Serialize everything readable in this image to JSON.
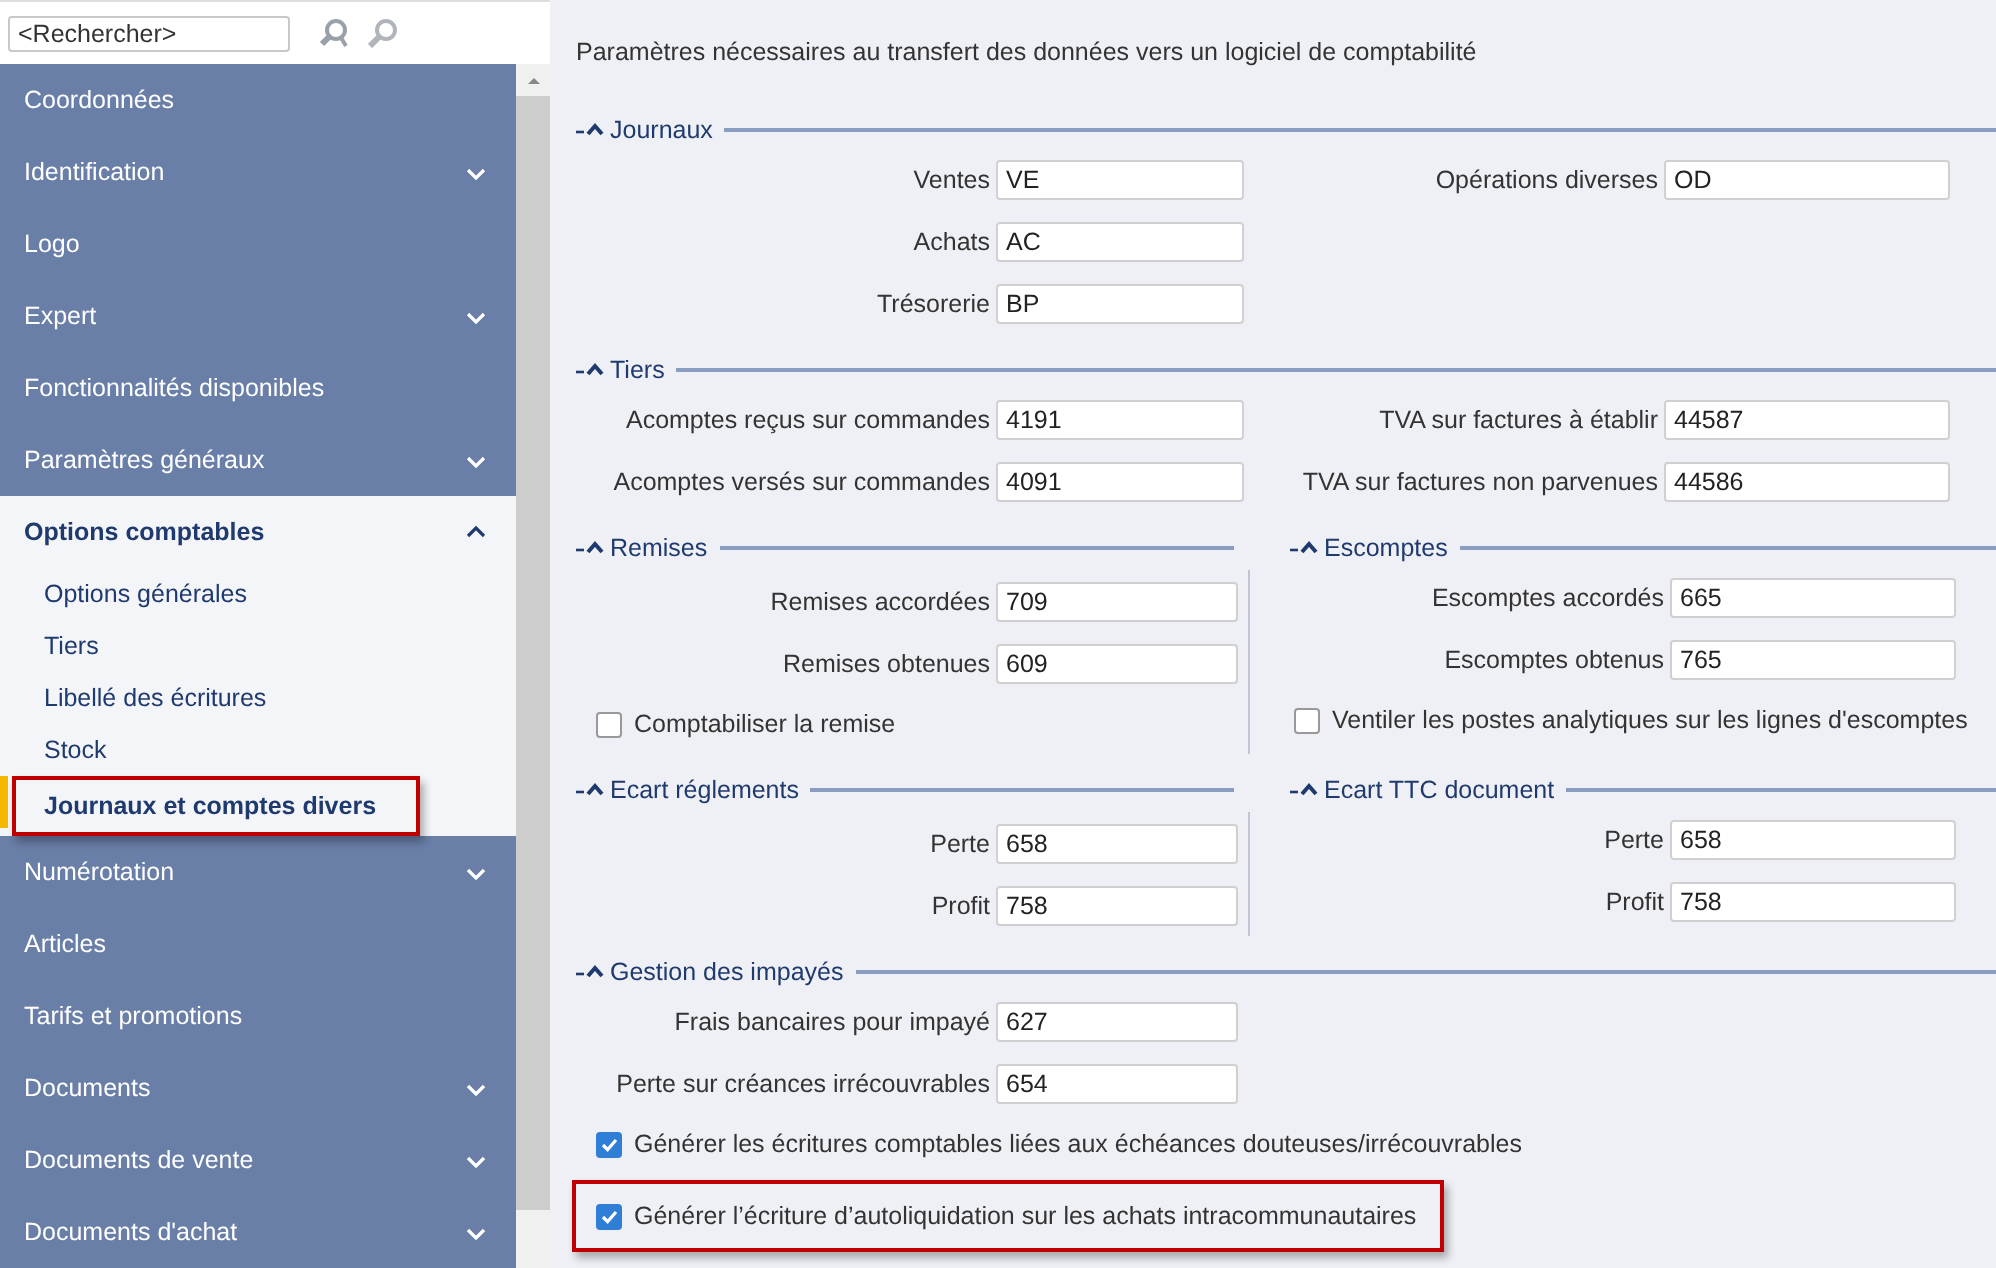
{
  "search": {
    "placeholder": "<Rechercher>"
  },
  "sidebar": {
    "items": [
      {
        "label": "Coordonnées",
        "kind": "link"
      },
      {
        "label": "Identification",
        "kind": "group",
        "expanded": false
      },
      {
        "label": "Logo",
        "kind": "link"
      },
      {
        "label": "Expert",
        "kind": "group",
        "expanded": false
      },
      {
        "label": "Fonctionnalités disponibles",
        "kind": "link"
      },
      {
        "label": "Paramètres généraux",
        "kind": "group",
        "expanded": false
      },
      {
        "label": "Options comptables",
        "kind": "group",
        "expanded": true,
        "children": [
          {
            "label": "Options générales",
            "selected": false,
            "highlighted": false
          },
          {
            "label": "Tiers",
            "selected": false,
            "highlighted": false
          },
          {
            "label": "Libellé des écritures",
            "selected": false,
            "highlighted": false
          },
          {
            "label": "Stock",
            "selected": false,
            "highlighted": false
          },
          {
            "label": "Journaux et comptes divers",
            "selected": true,
            "highlighted": true
          }
        ]
      },
      {
        "label": "Numérotation",
        "kind": "group",
        "expanded": false
      },
      {
        "label": "Articles",
        "kind": "link"
      },
      {
        "label": "Tarifs et promotions",
        "kind": "link"
      },
      {
        "label": "Documents",
        "kind": "group",
        "expanded": false
      },
      {
        "label": "Documents de vente",
        "kind": "group",
        "expanded": false
      },
      {
        "label": "Documents d'achat",
        "kind": "group",
        "expanded": false
      }
    ]
  },
  "panel": {
    "description": "Paramètres nécessaires au transfert des données vers un logiciel de comptabilité",
    "sections": [
      {
        "kind": "group",
        "title": "Journaux",
        "expanded": true,
        "columns": [
          [
            {
              "label": "Ventes",
              "value": "VE"
            },
            {
              "label": "Achats",
              "value": "AC"
            },
            {
              "label": "Trésorerie",
              "value": "BP"
            }
          ],
          [
            {
              "label": "Opérations diverses",
              "value": "OD"
            }
          ]
        ]
      },
      {
        "kind": "group",
        "title": "Tiers",
        "expanded": true,
        "columns": [
          [
            {
              "label": "Acomptes reçus sur commandes",
              "value": "4191"
            },
            {
              "label": "Acomptes versés sur commandes",
              "value": "4091"
            }
          ],
          [
            {
              "label": "TVA sur factures à établir",
              "value": "44587"
            },
            {
              "label": "TVA sur factures non parvenues",
              "value": "44586"
            }
          ]
        ]
      },
      {
        "kind": "split",
        "groups": [
          {
            "title": "Remises",
            "expanded": true,
            "columns": [
              [
                {
                  "label": "Remises accordées",
                  "value": "709"
                },
                {
                  "label": "Remises obtenues",
                  "value": "609"
                }
              ]
            ],
            "checkboxes": [
              {
                "label": "Comptabiliser la remise",
                "checked": false,
                "highlighted": false
              }
            ]
          },
          {
            "title": "Escomptes",
            "expanded": true,
            "columns": [
              [
                {
                  "label": "Escomptes accordés",
                  "value": "665"
                },
                {
                  "label": "Escomptes obtenus",
                  "value": "765"
                }
              ]
            ],
            "checkboxes": [
              {
                "label": "Ventiler les postes analytiques sur les lignes d'escomptes",
                "checked": false,
                "highlighted": false
              }
            ]
          }
        ]
      },
      {
        "kind": "split",
        "groups": [
          {
            "title": "Ecart réglements",
            "expanded": true,
            "columns": [
              [
                {
                  "label": "Perte",
                  "value": "658"
                },
                {
                  "label": "Profit",
                  "value": "758"
                }
              ]
            ]
          },
          {
            "title": "Ecart TTC document",
            "expanded": true,
            "columns": [
              [
                {
                  "label": "Perte",
                  "value": "658"
                },
                {
                  "label": "Profit",
                  "value": "758"
                }
              ]
            ]
          }
        ]
      },
      {
        "kind": "group",
        "title": "Gestion des impayés",
        "expanded": true,
        "columns": [
          [
            {
              "label": "Frais bancaires pour impayé",
              "value": "627"
            },
            {
              "label": "Perte sur créances irrécouvrables",
              "value": "654"
            }
          ]
        ],
        "checkboxes": [
          {
            "label": "Générer les écritures comptables liées aux échéances douteuses/irrécouvrables",
            "checked": true,
            "highlighted": false
          },
          {
            "label": "Générer l’écriture d’autoliquidation sur les achats intracommunautaires",
            "checked": true,
            "highlighted": true
          }
        ]
      }
    ]
  }
}
